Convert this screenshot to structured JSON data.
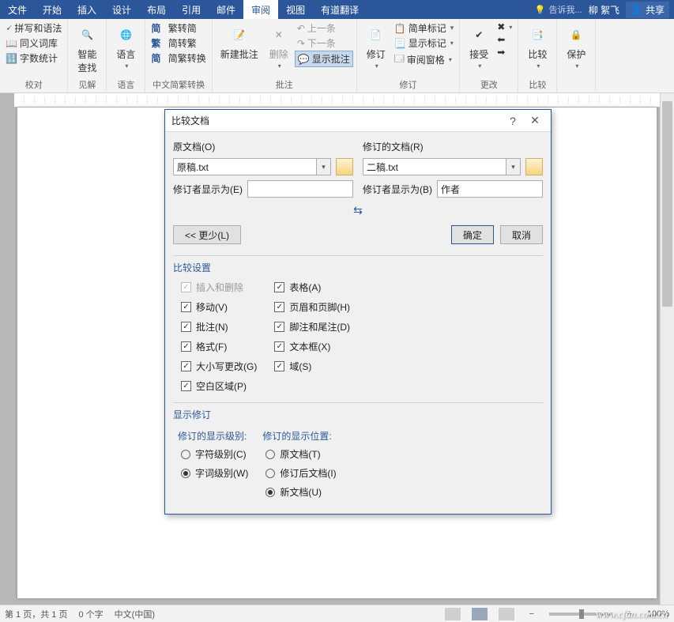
{
  "tabs": {
    "items": [
      "文件",
      "开始",
      "插入",
      "设计",
      "布局",
      "引用",
      "邮件",
      "审阅",
      "视图",
      "有道翻译"
    ],
    "active": 7,
    "tell": "告诉我...",
    "user": "柳 絮飞",
    "share": "共享"
  },
  "ribbon": {
    "g0": {
      "a": "拼写和语法",
      "b": "同义词库",
      "c": "字数统计",
      "label": "校对"
    },
    "g1": {
      "big": "智能\n查找",
      "label": "见解"
    },
    "g2": {
      "big": "语言",
      "label": "语言"
    },
    "g3": {
      "a": "繁转简",
      "b": "简转繁",
      "c": "简繁转换",
      "label": "中文简繁转换"
    },
    "g4": {
      "big1": "新建批注",
      "big2": "删除",
      "a": "上一条",
      "b": "下一条",
      "c": "显示批注",
      "label": "批注"
    },
    "g5": {
      "big": "修订",
      "dd": "简单标记",
      "a": "显示标记",
      "b": "审阅窗格",
      "label": "修订"
    },
    "g6": {
      "big": "接受",
      "label": "更改"
    },
    "g7": {
      "big": "比较",
      "label": "比较"
    },
    "g8": {
      "big": "保护",
      "label": ""
    }
  },
  "dialog": {
    "title": "比较文档",
    "original": {
      "label": "原文档(O)",
      "value": "原稿.txt",
      "reviser_lbl": "修订者显示为(E)",
      "reviser_val": ""
    },
    "revised": {
      "label": "修订的文档(R)",
      "value": "二稿.txt",
      "reviser_lbl": "修订者显示为(B)",
      "reviser_val": "作者"
    },
    "less": "<< 更少(L)",
    "ok": "确定",
    "cancel": "取消",
    "set_h": "比较设置",
    "left": [
      {
        "label": "插入和删除",
        "checked": true,
        "disabled": true
      },
      {
        "label": "移动(V)",
        "checked": true
      },
      {
        "label": "批注(N)",
        "checked": true
      },
      {
        "label": "格式(F)",
        "checked": true
      },
      {
        "label": "大小写更改(G)",
        "checked": true
      },
      {
        "label": "空白区域(P)",
        "checked": true
      }
    ],
    "right": [
      {
        "label": "表格(A)",
        "checked": true
      },
      {
        "label": "页眉和页脚(H)",
        "checked": true
      },
      {
        "label": "脚注和尾注(D)",
        "checked": true
      },
      {
        "label": "文本框(X)",
        "checked": true
      },
      {
        "label": "域(S)",
        "checked": true
      }
    ],
    "show_h": "显示修订",
    "level_h": "修订的显示级别:",
    "levels": [
      {
        "label": "字符级别(C)",
        "sel": false
      },
      {
        "label": "字词级别(W)",
        "sel": true
      }
    ],
    "pos_h": "修订的显示位置:",
    "positions": [
      {
        "label": "原文档(T)",
        "sel": false
      },
      {
        "label": "修订后文档(I)",
        "sel": false
      },
      {
        "label": "新文档(U)",
        "sel": true
      }
    ]
  },
  "status": {
    "page": "第 1 页，共 1 页",
    "words": "0 个字",
    "lang": "中文(中国)",
    "zoom": "100%"
  },
  "watermark": "www.cfan.com.cn"
}
